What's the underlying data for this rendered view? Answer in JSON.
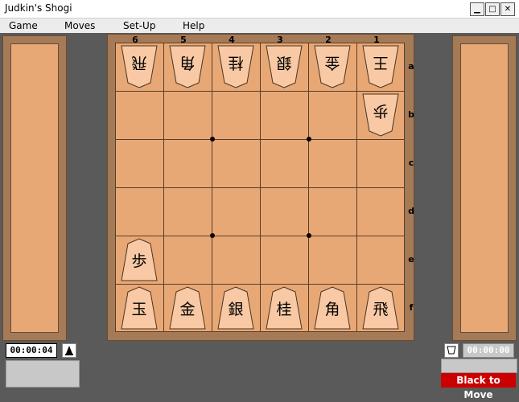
{
  "window": {
    "title": "Judkin's Shogi",
    "minimize_glyph": "▁",
    "maximize_glyph": "□",
    "close_glyph": "✕"
  },
  "menu": [
    "Game",
    "Moves",
    "Set-Up",
    "Help"
  ],
  "board": {
    "files": [
      "6",
      "5",
      "4",
      "3",
      "2",
      "1"
    ],
    "ranks": [
      "a",
      "b",
      "c",
      "d",
      "e",
      "f"
    ]
  },
  "pieces": [
    {
      "glyph": "飛",
      "side": "gote",
      "file": "6",
      "rank": "a"
    },
    {
      "glyph": "角",
      "side": "gote",
      "file": "5",
      "rank": "a"
    },
    {
      "glyph": "桂",
      "side": "gote",
      "file": "4",
      "rank": "a"
    },
    {
      "glyph": "銀",
      "side": "gote",
      "file": "3",
      "rank": "a"
    },
    {
      "glyph": "金",
      "side": "gote",
      "file": "2",
      "rank": "a"
    },
    {
      "glyph": "王",
      "side": "gote",
      "file": "1",
      "rank": "a"
    },
    {
      "glyph": "歩",
      "side": "gote",
      "file": "1",
      "rank": "b"
    },
    {
      "glyph": "歩",
      "side": "sente",
      "file": "6",
      "rank": "e"
    },
    {
      "glyph": "玉",
      "side": "sente",
      "file": "6",
      "rank": "f"
    },
    {
      "glyph": "金",
      "side": "sente",
      "file": "5",
      "rank": "f"
    },
    {
      "glyph": "銀",
      "side": "sente",
      "file": "4",
      "rank": "f"
    },
    {
      "glyph": "桂",
      "side": "sente",
      "file": "3",
      "rank": "f"
    },
    {
      "glyph": "角",
      "side": "sente",
      "file": "2",
      "rank": "f"
    },
    {
      "glyph": "飛",
      "side": "sente",
      "file": "1",
      "rank": "f"
    }
  ],
  "clocks": {
    "left": "00:00:04",
    "right": "00:00:00"
  },
  "status": "Black to Move",
  "colors": {
    "board": "#e8a876",
    "frame": "#a57a57",
    "status_bg": "#cc0000"
  }
}
